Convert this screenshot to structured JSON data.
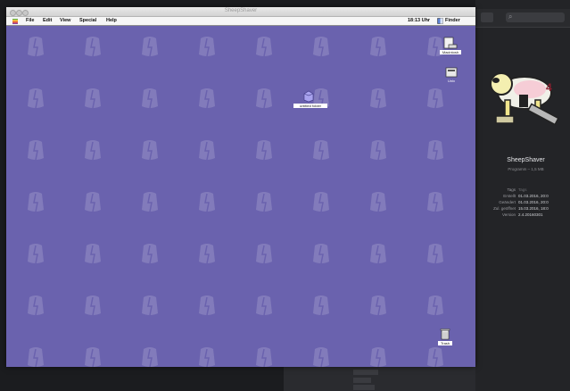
{
  "emulator_window": {
    "title": "SheepShaver"
  },
  "mac_menubar": {
    "apple_icon": "apple-icon",
    "menus": [
      "File",
      "Edit",
      "View",
      "Special",
      "Help"
    ],
    "clock": "18:13 Uhr",
    "app_name": "Finder",
    "app_icon": "finder-icon"
  },
  "desktop": {
    "background_color": "#6a62ae",
    "icons": [
      {
        "name": "hard-disk",
        "label": "Macintosh",
        "icon": "hard-disk-icon"
      },
      {
        "name": "shared-disk",
        "label": "Unix",
        "icon": "disk-drive-icon"
      },
      {
        "name": "folder",
        "label": "untitled folder",
        "icon": "folder-icon"
      },
      {
        "name": "trash",
        "label": "Trash",
        "icon": "trash-icon"
      }
    ]
  },
  "control_strip": {
    "module_colors": [
      "#d8d8d8",
      "#c9c9c9",
      "#3b7bd6",
      "#d9d9d9",
      "#c13a3a",
      "#e0e0e0",
      "#5d5d5d",
      "#d0d0d0",
      "#7a7a7a",
      "#dadada",
      "#5a8a5a",
      "#cfcfcf",
      "#d3d3d3",
      "#e3e3e3",
      "#8d8d8d",
      "#d6d6d6",
      "#4a6cc8",
      "#d1d1d1",
      "#3ea63e",
      "#d0d0d0",
      "#d8d8d8",
      "#cccccc",
      "#dedede",
      "#b0b0b0"
    ]
  },
  "finder_info": {
    "app_icon": "sheepshaver-icon",
    "name": "SheepShaver",
    "kind": "Programm – 1,5 MB",
    "rows": [
      {
        "key": "Tags",
        "value": "Tags"
      },
      {
        "key": "Erstellt",
        "value": "01.03.2016, 20:0"
      },
      {
        "key": "Geändert",
        "value": "01.03.2016, 20:0"
      },
      {
        "key": "Zul. geöffnet",
        "value": "15.03.2016, 18:0"
      },
      {
        "key": "Version",
        "value": "2.4.20160301"
      }
    ]
  },
  "accent_colors": {
    "desktop": "#6a62ae",
    "finder_dark": "#232427"
  }
}
